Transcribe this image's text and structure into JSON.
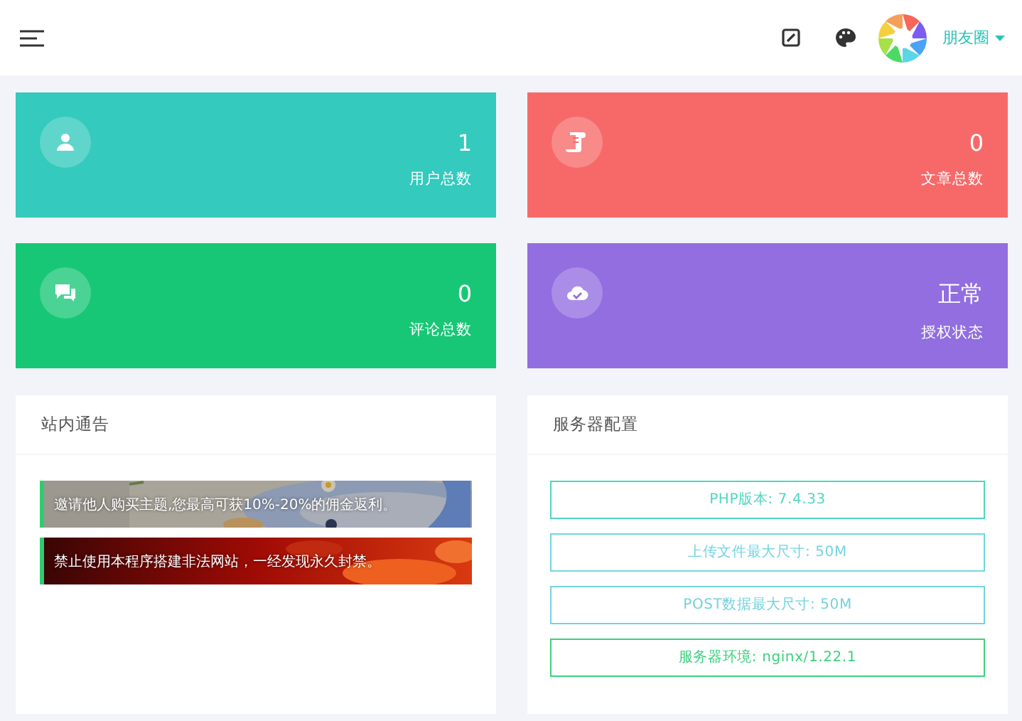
{
  "topbar": {
    "user": {
      "name": "朋友圈"
    }
  },
  "stats": [
    {
      "value": "1",
      "label": "用户总数",
      "color": "#34cabd"
    },
    {
      "value": "0",
      "label": "文章总数",
      "color": "#f76969"
    },
    {
      "value": "0",
      "label": "评论总数",
      "color": "#18c776"
    },
    {
      "value": "正常",
      "label": "授权状态",
      "color": "#926ee0"
    }
  ],
  "notices": {
    "title": "站内通告",
    "items": [
      {
        "text": "邀请他人购买主题,您最高可获10%-20%的佣金返利。"
      },
      {
        "text": "禁止使用本程序搭建非法网站，一经发现永久封禁。"
      }
    ]
  },
  "server": {
    "title": "服务器配置",
    "items": [
      {
        "text": "PHP版本: 7.4.33",
        "color": "#4fd6c2"
      },
      {
        "text": "上传文件最大尺寸: 50M",
        "color": "#72d5e0"
      },
      {
        "text": "POST数据最大尺寸: 50M",
        "color": "#75d2dc"
      },
      {
        "text": "服务器环境: nginx/1.22.1",
        "color": "#3ed07e"
      }
    ]
  }
}
